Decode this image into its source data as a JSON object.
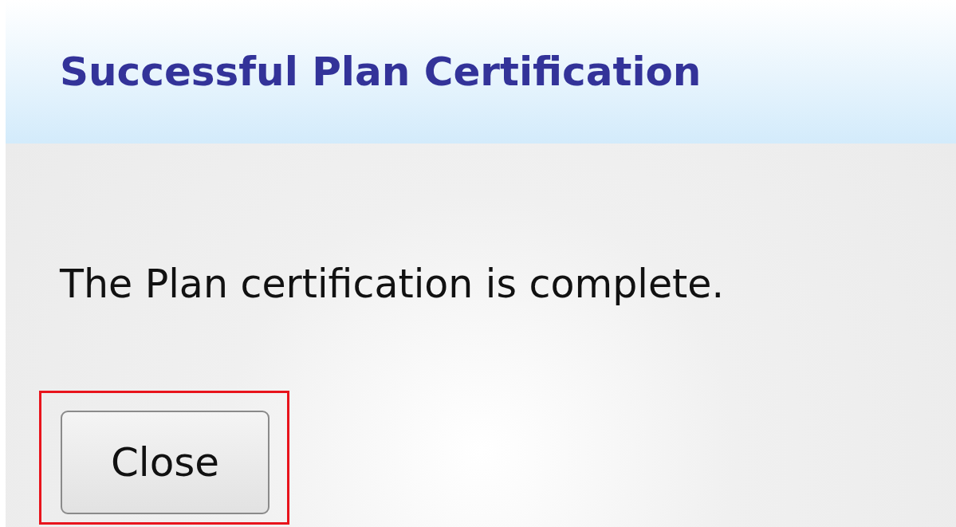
{
  "dialog": {
    "title": "Successful Plan Certification",
    "message": "The Plan certification is complete.",
    "buttons": [
      {
        "label": "Close",
        "highlighted": true
      }
    ]
  }
}
